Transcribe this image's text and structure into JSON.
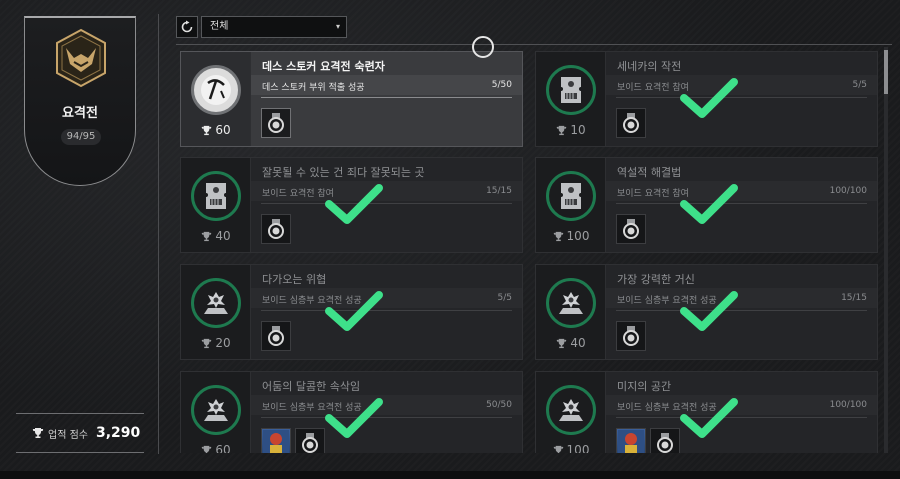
{
  "sidebar": {
    "category_title": "요격전",
    "progress_count": "94/95",
    "score_label": "업적 점수",
    "score_value": "3,290"
  },
  "toolbar": {
    "refresh_icon": "refresh-icon",
    "filter_value": "전체",
    "filter_arrow": "▾"
  },
  "colors": {
    "complete_green": "#3ee08a",
    "badge_ring": "#1e7a4f",
    "gold": "#c8a56a"
  },
  "achievements": [
    {
      "title": "데스 스토커 요격전 숙련자",
      "description": "데스 스토커 부위 적출 성공",
      "progress": "5/50",
      "points": "60",
      "icon": "pickaxe-icon",
      "completed": false,
      "selected": true
    },
    {
      "title": "세네카의 작전",
      "description": "보이드 요격전 참여",
      "progress": "5/5",
      "points": "10",
      "icon": "ticket-icon",
      "completed": true
    },
    {
      "title": "잘못될 수 있는 건 죄다 잘못되는 곳",
      "description": "보이드 요격전 참여",
      "progress": "15/15",
      "points": "40",
      "icon": "ticket-icon",
      "completed": true
    },
    {
      "title": "역설적 해결법",
      "description": "보이드 요격전 참여",
      "progress": "100/100",
      "points": "100",
      "icon": "ticket-icon",
      "completed": true
    },
    {
      "title": "다가오는 위협",
      "description": "보이드 심층부 요격전 성공",
      "progress": "5/5",
      "points": "20",
      "icon": "boss-icon",
      "completed": true
    },
    {
      "title": "가장 강력한 거신",
      "description": "보이드 심층부 요격전 성공",
      "progress": "15/15",
      "points": "40",
      "icon": "boss-icon",
      "completed": true
    },
    {
      "title": "어둠의 달콤한 속삭임",
      "description": "보이드 심층부 요격전 성공",
      "progress": "50/50",
      "points": "60",
      "icon": "boss-icon",
      "completed": true
    },
    {
      "title": "미지의 공간",
      "description": "보이드 심층부 요격전 성공",
      "progress": "100/100",
      "points": "100",
      "icon": "boss-icon",
      "completed": true
    }
  ]
}
